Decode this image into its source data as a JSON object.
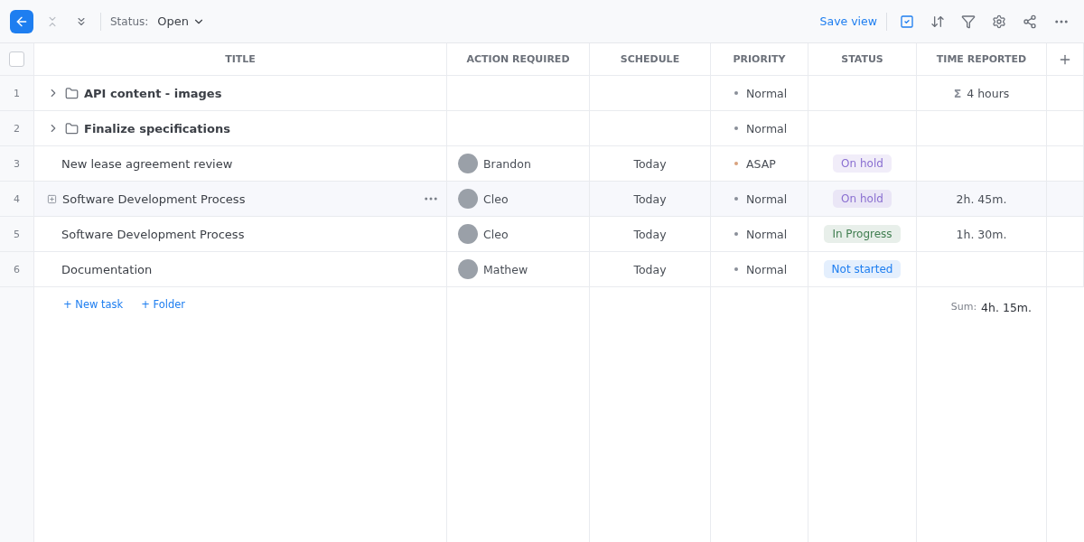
{
  "toolbar": {
    "status_label": "Status:",
    "status_value": "Open",
    "save_view": "Save view"
  },
  "table": {
    "select_all": {
      "checked": false
    },
    "columns": [
      "TITLE",
      "ACTION REQUIRED",
      "SCHEDULE",
      "PRIORITY",
      "STATUS",
      "TIME REPORTED"
    ],
    "rows": [
      {
        "number": "1",
        "kind": "folder",
        "hovered": false,
        "title": "API content - images",
        "priority": {
          "text": "Normal",
          "color": "#8a8f99"
        },
        "time": {
          "prefix": "Σ",
          "text": "4 hours"
        }
      },
      {
        "number": "2",
        "kind": "folder",
        "hovered": false,
        "title": "Finalize specifications",
        "priority": {
          "text": "Normal",
          "color": "#8a8f99"
        }
      },
      {
        "number": "3",
        "kind": "task",
        "hovered": false,
        "title": "New lease agreement review",
        "assignee": "Brandon",
        "schedule": "Today",
        "priority": {
          "text": "ASAP",
          "color": "#d9a27e"
        },
        "status": {
          "text": "On hold",
          "color": "#8a6fd1"
        }
      },
      {
        "number": "4",
        "kind": "task",
        "hovered": true,
        "title": "Software Development Process",
        "assignee": "Cleo",
        "schedule": "Today",
        "priority": {
          "text": "Normal",
          "color": "#8a8f99"
        },
        "status": {
          "text": "On hold",
          "color": "#8a6fd1"
        },
        "time": {
          "text": "2h. 45m."
        }
      },
      {
        "number": "5",
        "kind": "task",
        "hovered": false,
        "title": "Software Development Process",
        "assignee": "Cleo",
        "schedule": "Today",
        "priority": {
          "text": "Normal",
          "color": "#8a8f99"
        },
        "status": {
          "text": "In Progress",
          "color": "#3f7d4f"
        },
        "time": {
          "text": "1h. 30m."
        }
      },
      {
        "number": "6",
        "kind": "task",
        "hovered": false,
        "title": "Documentation",
        "assignee": "Mathew",
        "schedule": "Today",
        "priority": {
          "text": "Normal",
          "color": "#8a8f99"
        },
        "status": {
          "text": "Not started",
          "color": "#1e7ef0"
        }
      }
    ],
    "add_links": [
      "+ New task",
      "+ Folder"
    ],
    "sum_label": "Sum:",
    "sum_value": "4h. 15m."
  }
}
